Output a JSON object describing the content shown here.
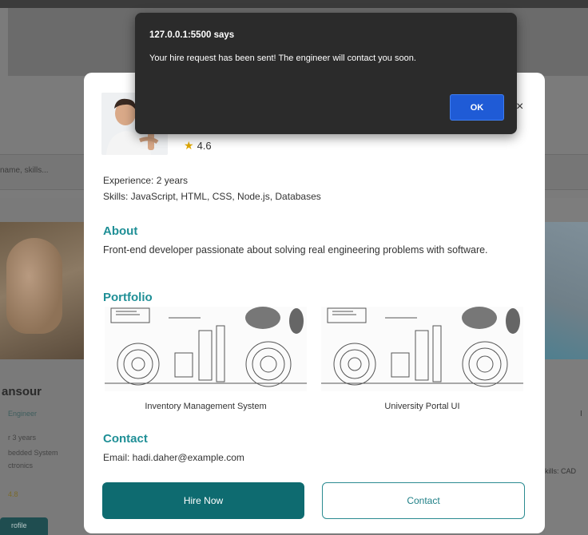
{
  "background": {
    "search_placeholder": "name, skills...",
    "left_card": {
      "name": "ansour",
      "role": "Engineer",
      "experience": "r 3 years",
      "skills_line1": "bedded System",
      "skills_line2": "ctronics",
      "rating": "4.8",
      "button_label": "rofile"
    },
    "right_card": {
      "letter": "I",
      "skills": "kills: CAD"
    }
  },
  "modal": {
    "rating": "4.6",
    "close_label": "×",
    "experience": "Experience: 2 years",
    "skills": "Skills: JavaScript, HTML, CSS, Node.js, Databases",
    "about_title": "About",
    "about_text": "Front-end developer passionate about solving real engineering problems with software.",
    "portfolio_title": "Portfolio",
    "portfolio": [
      {
        "caption": "Inventory Management System"
      },
      {
        "caption": "University Portal UI"
      }
    ],
    "contact_title": "Contact",
    "email": "Email: hadi.daher@example.com",
    "hire_button": "Hire Now",
    "contact_button": "Contact"
  },
  "alert": {
    "title": "127.0.0.1:5500 says",
    "message": "Your hire request has been sent! The engineer will contact you soon.",
    "ok_label": "OK"
  },
  "colors": {
    "accent": "#0e6b70",
    "section_title": "#1f8f96",
    "alert_bg": "#2b2b2b",
    "ok_button": "#1f5bd6",
    "star": "#e0a800"
  }
}
